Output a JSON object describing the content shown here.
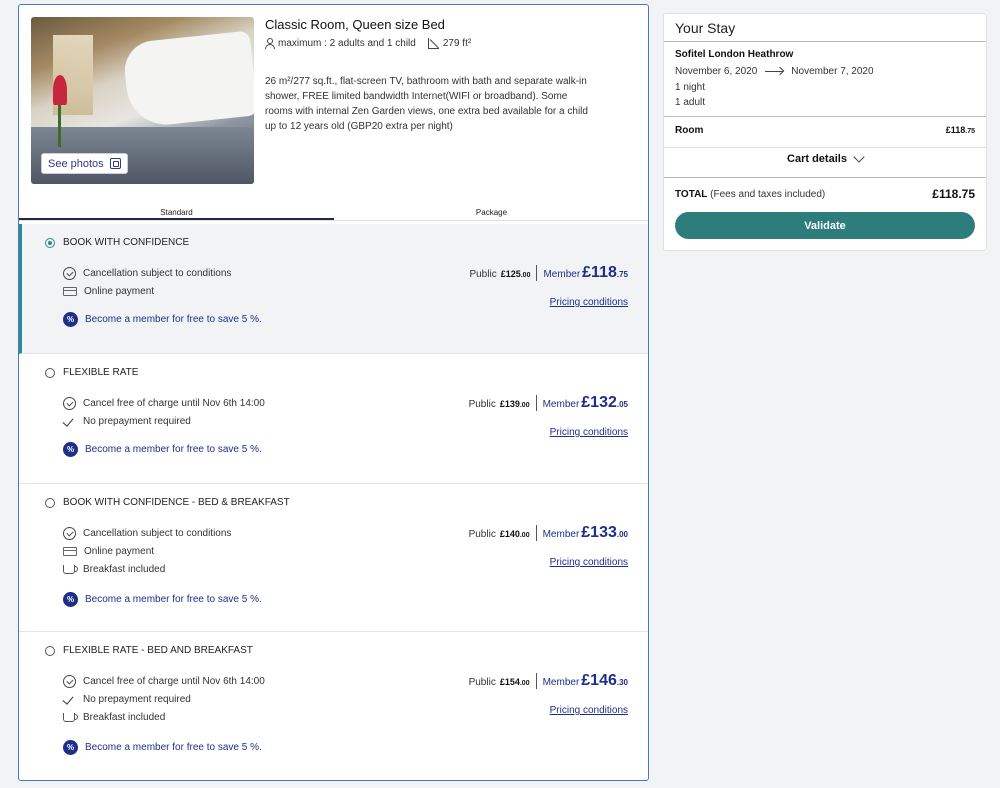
{
  "room": {
    "title": "Classic Room, Queen size Bed",
    "capacity": "maximum : 2 adults and 1 child",
    "area": "279 ft²",
    "description": "26 m²/277 sq.ft., flat-screen TV, bathroom with bath and separate walk-in shower, FREE limited bandwidth Internet(WIFI or broadband). Some rooms with internal Zen Garden views, one extra bed available for a child up to 12 years old (GBP20 extra per night)",
    "see_photos": "See photos"
  },
  "tabs": [
    {
      "label": "Standard",
      "active": true
    },
    {
      "label": "Package",
      "active": false
    }
  ],
  "rates": [
    {
      "name": "BOOK WITH CONFIDENCE",
      "selected": true,
      "features": [
        {
          "icon": "clock-check-icon",
          "text": "Cancellation subject to conditions"
        },
        {
          "icon": "credit-card-icon",
          "text": "Online payment"
        }
      ],
      "public_label": "Public",
      "public_main": "£125",
      "public_dec": ".00",
      "member_label": "Member",
      "member_main": "£118",
      "member_dec": ".75",
      "pricing_link": "Pricing conditions",
      "promo": "Become a member for free to save 5 %."
    },
    {
      "name": "FLEXIBLE RATE",
      "selected": false,
      "features": [
        {
          "icon": "clock-check-icon",
          "text": "Cancel free of charge until Nov 6th 14:00"
        },
        {
          "icon": "check-icon",
          "text": "No prepayment required"
        }
      ],
      "public_label": "Public",
      "public_main": "£139",
      "public_dec": ".00",
      "member_label": "Member",
      "member_main": "£132",
      "member_dec": ".05",
      "pricing_link": "Pricing conditions",
      "promo": "Become a member for free to save 5 %."
    },
    {
      "name": "BOOK WITH CONFIDENCE - BED & BREAKFAST",
      "selected": false,
      "features": [
        {
          "icon": "clock-check-icon",
          "text": "Cancellation subject to conditions"
        },
        {
          "icon": "credit-card-icon",
          "text": "Online payment"
        },
        {
          "icon": "cup-icon",
          "text": "Breakfast included"
        }
      ],
      "public_label": "Public",
      "public_main": "£140",
      "public_dec": ".00",
      "member_label": "Member",
      "member_main": "£133",
      "member_dec": ".00",
      "pricing_link": "Pricing conditions",
      "promo": "Become a member for free to save 5 %."
    },
    {
      "name": "FLEXIBLE RATE - BED AND BREAKFAST",
      "selected": false,
      "features": [
        {
          "icon": "clock-check-icon",
          "text": "Cancel free of charge until Nov 6th 14:00"
        },
        {
          "icon": "check-icon",
          "text": "No prepayment required"
        },
        {
          "icon": "cup-icon",
          "text": "Breakfast included"
        }
      ],
      "public_label": "Public",
      "public_main": "£154",
      "public_dec": ".00",
      "member_label": "Member",
      "member_main": "£146",
      "member_dec": ".30",
      "pricing_link": "Pricing conditions",
      "promo": "Become a member for free to save 5 %."
    }
  ],
  "stay": {
    "title": "Your Stay",
    "hotel": "Sofitel London Heathrow",
    "check_in": "November 6, 2020",
    "check_out": "November 7, 2020",
    "nights": "1 night",
    "adults": "1 adult",
    "room_label": "Room",
    "room_price_main": "£118",
    "room_price_dec": ".75",
    "cart_details": "Cart details",
    "total_label": "TOTAL",
    "total_note": " (Fees and taxes included)",
    "total_price": "£118.75",
    "validate": "Validate"
  },
  "colors": {
    "accent_teal": "#2d7d7d",
    "member_blue": "#1e2f8a",
    "card_border": "#4a78c9"
  }
}
